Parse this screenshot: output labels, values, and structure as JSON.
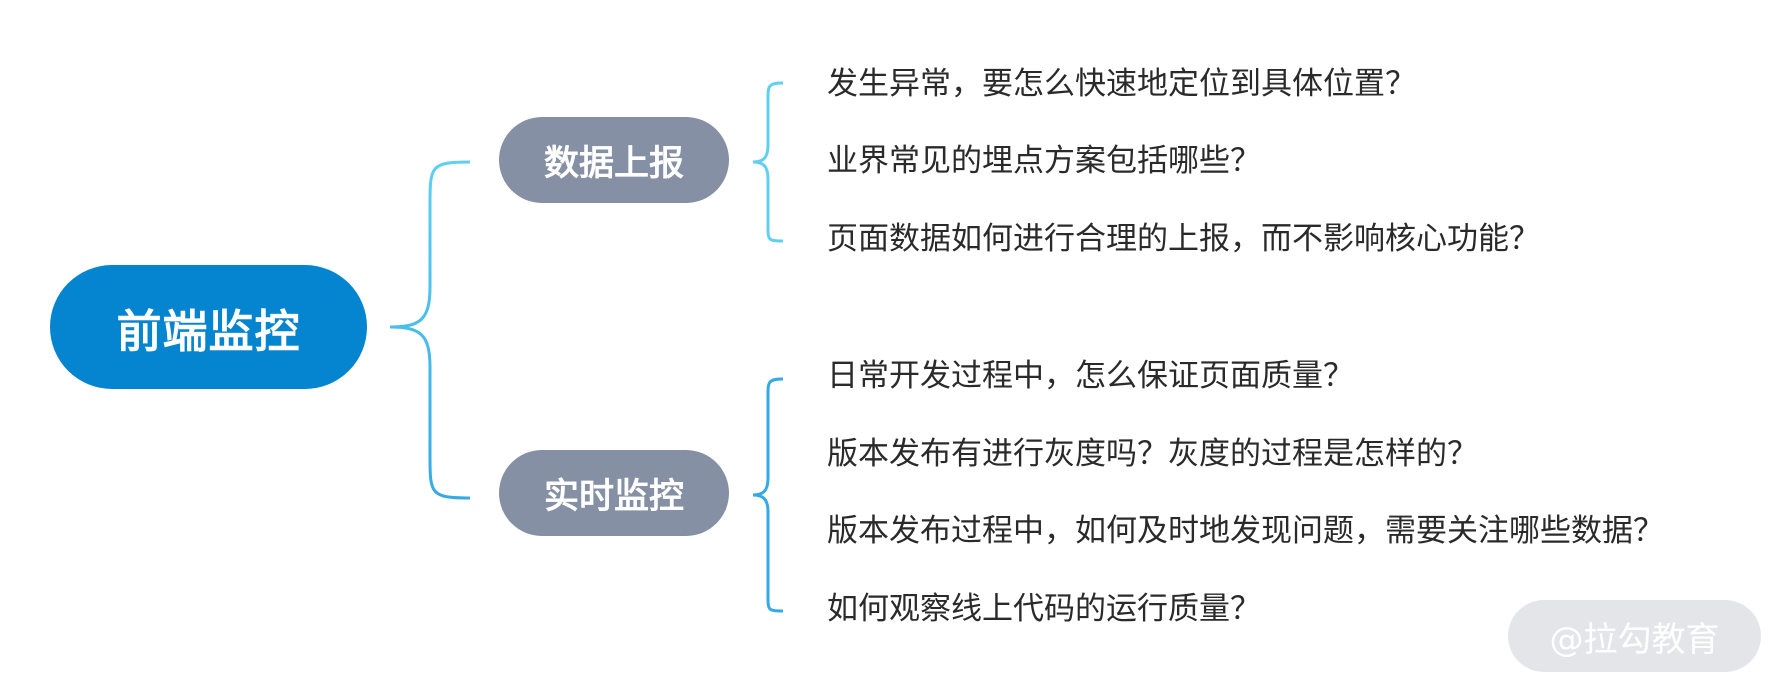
{
  "root": {
    "label": "前端监控"
  },
  "branches": [
    {
      "label": "数据上报",
      "questions": [
        "发生异常，要怎么快速地定位到具体位置？",
        "业界常见的埋点方案包括哪些？",
        "页面数据如何进行合理的上报，而不影响核心功能？"
      ]
    },
    {
      "label": "实时监控",
      "questions": [
        "日常开发过程中，怎么保证页面质量？",
        "版本发布有进行灰度吗？灰度的过程是怎样的？",
        "版本发布过程中，如何及时地发现问题，需要关注哪些数据？",
        "如何观察线上代码的运行质量？"
      ]
    }
  ],
  "watermark": {
    "text": "@拉勾教育"
  },
  "colors": {
    "root": "#0584cf",
    "branch": "#8590a4",
    "connector_top": "#5fd0f2",
    "connector_bottom": "#35a9e6"
  }
}
